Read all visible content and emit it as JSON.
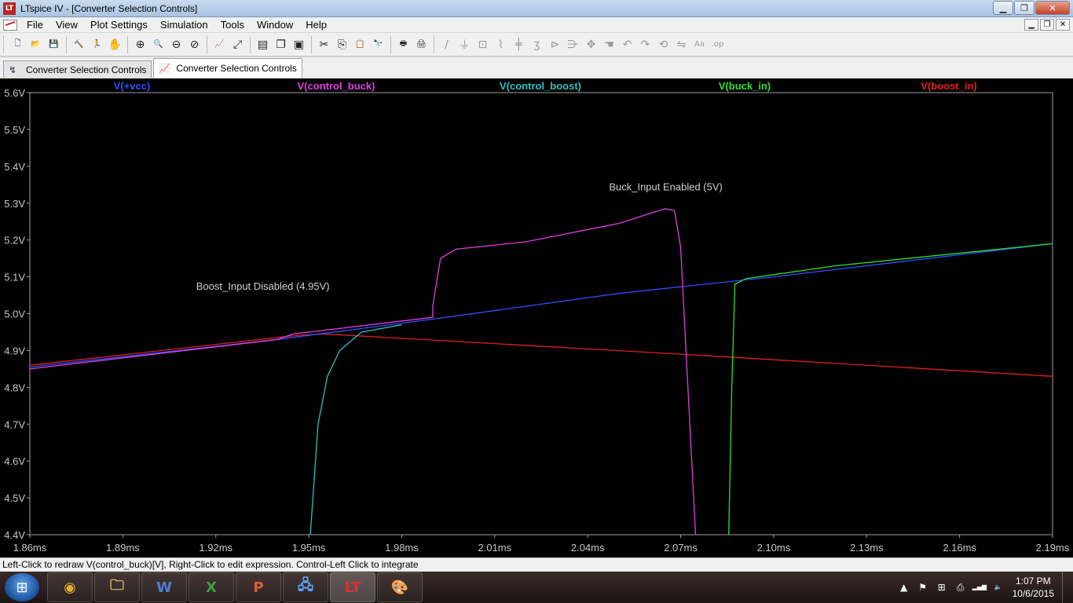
{
  "window": {
    "title": "LTspice IV - [Converter Selection Controls]",
    "app_icon": "ltspice-icon",
    "buttons": {
      "minimize": "▁",
      "maximize": "❐",
      "close": "✕"
    }
  },
  "menu": {
    "items": [
      "File",
      "View",
      "Plot Settings",
      "Simulation",
      "Tools",
      "Window",
      "Help"
    ],
    "mdi_buttons": [
      "▁",
      "❐",
      "✕"
    ]
  },
  "toolbar": {
    "groups": [
      [
        "new-schematic-icon",
        "open-icon",
        "save-icon"
      ],
      [
        "control-panel-icon",
        "run-icon",
        "halt-icon"
      ],
      [
        "zoom-in-icon",
        "zoom-out-icon",
        "zoom-back-icon",
        "zoom-cancel-icon"
      ],
      [
        "autorange-icon",
        "fit-icon"
      ],
      [
        "tile-horizontal-icon",
        "cascade-icon",
        "close-all-icon"
      ],
      [
        "cut-icon",
        "copy-icon",
        "paste-icon",
        "find-icon"
      ],
      [
        "print-preview-icon",
        "print-icon"
      ],
      [
        "wire-icon",
        "ground-icon",
        "label-icon",
        "resistor-icon",
        "capacitor-icon",
        "inductor-icon",
        "diode-icon",
        "component-icon",
        "move-icon",
        "drag-icon",
        "undo-icon",
        "redo-icon",
        "rotate-icon",
        "mirror-icon",
        "text-icon",
        "spice-directive-icon"
      ]
    ],
    "glyphs": {
      "new-schematic-icon": "🗋",
      "open-icon": "📂",
      "save-icon": "💾",
      "control-panel-icon": "🔨",
      "run-icon": "🏃",
      "halt-icon": "✋",
      "zoom-in-icon": "⊕",
      "zoom-out-icon": "🔍",
      "zoom-back-icon": "⊖",
      "zoom-cancel-icon": "⊘",
      "autorange-icon": "📈",
      "fit-icon": "⤢",
      "tile-horizontal-icon": "▤",
      "cascade-icon": "❐",
      "close-all-icon": "▣",
      "cut-icon": "✂",
      "copy-icon": "⎘",
      "paste-icon": "📋",
      "find-icon": "🔭",
      "print-preview-icon": "🖶",
      "print-icon": "🖨",
      "wire-icon": "∕",
      "ground-icon": "⏚",
      "label-icon": "⊡",
      "resistor-icon": "⌇",
      "capacitor-icon": "╪",
      "inductor-icon": "ʒ",
      "diode-icon": "⊳",
      "component-icon": "⋺",
      "move-icon": "✥",
      "drag-icon": "☚",
      "undo-icon": "↶",
      "redo-icon": "↷",
      "rotate-icon": "⟲",
      "mirror-icon": "⇋",
      "text-icon": "Aa",
      "spice-directive-icon": ".op"
    }
  },
  "tabs": [
    {
      "label": "Converter Selection Controls",
      "icon": "schematic-icon",
      "glyph": "↯",
      "active": false
    },
    {
      "label": "Converter Selection Controls",
      "icon": "waveform-icon",
      "glyph": "📈",
      "active": true
    }
  ],
  "plot": {
    "background": "#000000",
    "axis_color": "#a0a0a0",
    "traces": [
      {
        "name": "V(+vcc)",
        "color": "#3050ff"
      },
      {
        "name": "V(control_buck)",
        "color": "#e040e0"
      },
      {
        "name": "V(control_boost)",
        "color": "#30c0c0"
      },
      {
        "name": "V(buck_in)",
        "color": "#30e030"
      },
      {
        "name": "V(boost_in)",
        "color": "#e02020"
      }
    ],
    "y_ticks": [
      "5.6V",
      "5.5V",
      "5.4V",
      "5.3V",
      "5.2V",
      "5.1V",
      "5.0V",
      "4.9V",
      "4.8V",
      "4.7V",
      "4.6V",
      "4.5V",
      "4.4V"
    ],
    "x_ticks": [
      "1.86ms",
      "1.89ms",
      "1.92ms",
      "1.95ms",
      "1.98ms",
      "2.01ms",
      "2.04ms",
      "2.07ms",
      "2.10ms",
      "2.13ms",
      "2.16ms",
      "2.19ms"
    ],
    "annotations": [
      {
        "text": "Buck_Input Enabled (5V)",
        "x": 2.0652,
        "y": 5.335
      },
      {
        "text": "Boost_Input Disabled (4.95V)",
        "x": 1.9352,
        "y": 5.065
      }
    ]
  },
  "chart_data": {
    "type": "line",
    "title": "",
    "xlabel": "",
    "ylabel": "",
    "xlim": [
      1.86,
      2.19
    ],
    "ylim": [
      4.4,
      5.6
    ],
    "x_unit": "ms",
    "y_unit": "V",
    "grid": false,
    "legend": "top",
    "series": [
      {
        "name": "V(+vcc)",
        "color": "#3050ff",
        "x": [
          1.86,
          1.94,
          1.99,
          2.05,
          2.1,
          2.19
        ],
        "y": [
          4.855,
          4.93,
          4.985,
          5.055,
          5.1,
          5.19
        ]
      },
      {
        "name": "V(control_buck)",
        "color": "#e040e0",
        "x": [
          1.86,
          1.9,
          1.94,
          1.945,
          1.95,
          1.99,
          1.99,
          1.9925,
          1.9975,
          2.02,
          2.05,
          2.065,
          2.068,
          2.07,
          2.0748
        ],
        "y": [
          4.85,
          4.89,
          4.93,
          4.945,
          4.95,
          4.99,
          5.02,
          5.15,
          5.175,
          5.195,
          5.245,
          5.285,
          5.28,
          5.18,
          4.4
        ]
      },
      {
        "name": "V(control_boost)",
        "color": "#30c0c0",
        "x": [
          1.9505,
          1.953,
          1.956,
          1.96,
          1.967,
          1.98
        ],
        "y": [
          4.4,
          4.7,
          4.83,
          4.9,
          4.95,
          4.97
        ]
      },
      {
        "name": "V(buck_in)",
        "color": "#30e030",
        "x": [
          2.0855,
          2.0865,
          2.0875,
          2.091,
          2.12,
          2.19
        ],
        "y": [
          4.4,
          4.8,
          5.08,
          5.095,
          5.13,
          5.19
        ]
      },
      {
        "name": "V(boost_in)",
        "color": "#e02020",
        "x": [
          1.86,
          1.945,
          1.955,
          2.07,
          2.19
        ],
        "y": [
          4.86,
          4.94,
          4.945,
          4.89,
          4.83
        ]
      }
    ]
  },
  "status": {
    "text": "Left-Click to redraw V(control_buck)[V],  Right-Click to edit expression. Control-Left Click to integrate"
  },
  "taskbar": {
    "start": "⊞",
    "apps": [
      {
        "icon": "chrome-icon",
        "glyph": "◉",
        "color": "#e8b030",
        "active": false
      },
      {
        "icon": "explorer-icon",
        "glyph": "🗀",
        "color": "#f0d070",
        "active": false
      },
      {
        "icon": "word-icon",
        "glyph": "W",
        "color": "#4a7fd0",
        "active": false
      },
      {
        "icon": "excel-icon",
        "glyph": "X",
        "color": "#3aa040",
        "active": false
      },
      {
        "icon": "powerpoint-icon",
        "glyph": "P",
        "color": "#e06030",
        "active": false
      },
      {
        "icon": "network-icon",
        "glyph": "🖧",
        "color": "#60a0f0",
        "active": false
      },
      {
        "icon": "ltspice-icon",
        "glyph": "LT",
        "color": "#e03030",
        "active": true
      },
      {
        "icon": "paint-icon",
        "glyph": "🎨",
        "color": "#90c0f0",
        "active": false
      }
    ],
    "tray": [
      {
        "icon": "show-hidden-icon",
        "glyph": "▲"
      },
      {
        "icon": "flag-icon",
        "glyph": "⚑"
      },
      {
        "icon": "windows-icon",
        "glyph": "⊞"
      },
      {
        "icon": "device-icon",
        "glyph": "⎙"
      },
      {
        "icon": "signal-icon",
        "glyph": "▂▄▆"
      },
      {
        "icon": "volume-icon",
        "glyph": "🔈"
      }
    ],
    "time": "1:07 PM",
    "date": "10/6/2015"
  }
}
